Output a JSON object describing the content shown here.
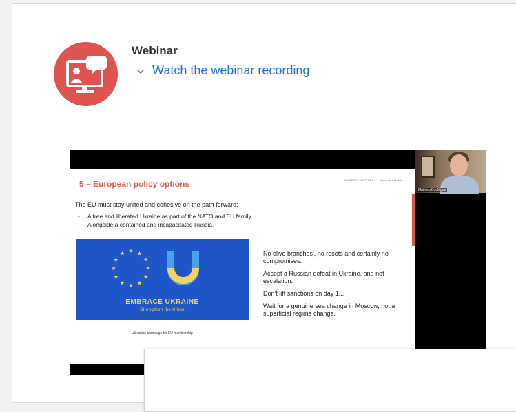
{
  "webinar": {
    "heading": "Webinar",
    "link_label": "Watch the webinar recording",
    "icon_color": "#e0544f",
    "link_color": "#2a6fd6"
  },
  "slide": {
    "title": "5 – European policy options",
    "logos": [
      "WILFRIED MARTENS",
      "Alexander Stubb"
    ],
    "intro": "The EU must stay united and cohesive on the path forward:",
    "bullets": [
      "A free and liberated Ukraine as part of the NATO and EU family",
      "Alongside a contained and incapacitated Russia."
    ],
    "flag_title": "EMBRACE UKRAINE",
    "flag_subtitle": "Strengthen the Union",
    "caption": "Ukrainian campaign for EU membership",
    "points": [
      "No olive branches', no resets and certainly no compromises.",
      "Accept a Russian defeat in Ukraine, and not escalation.",
      "Don't lift sanctions on day 1...",
      "Wait for a genuine sea change in Moscow, not a superficial regime change."
    ],
    "accent_color": "#d95b47"
  },
  "webcam": {
    "name": "Mathieu Boulègue"
  }
}
